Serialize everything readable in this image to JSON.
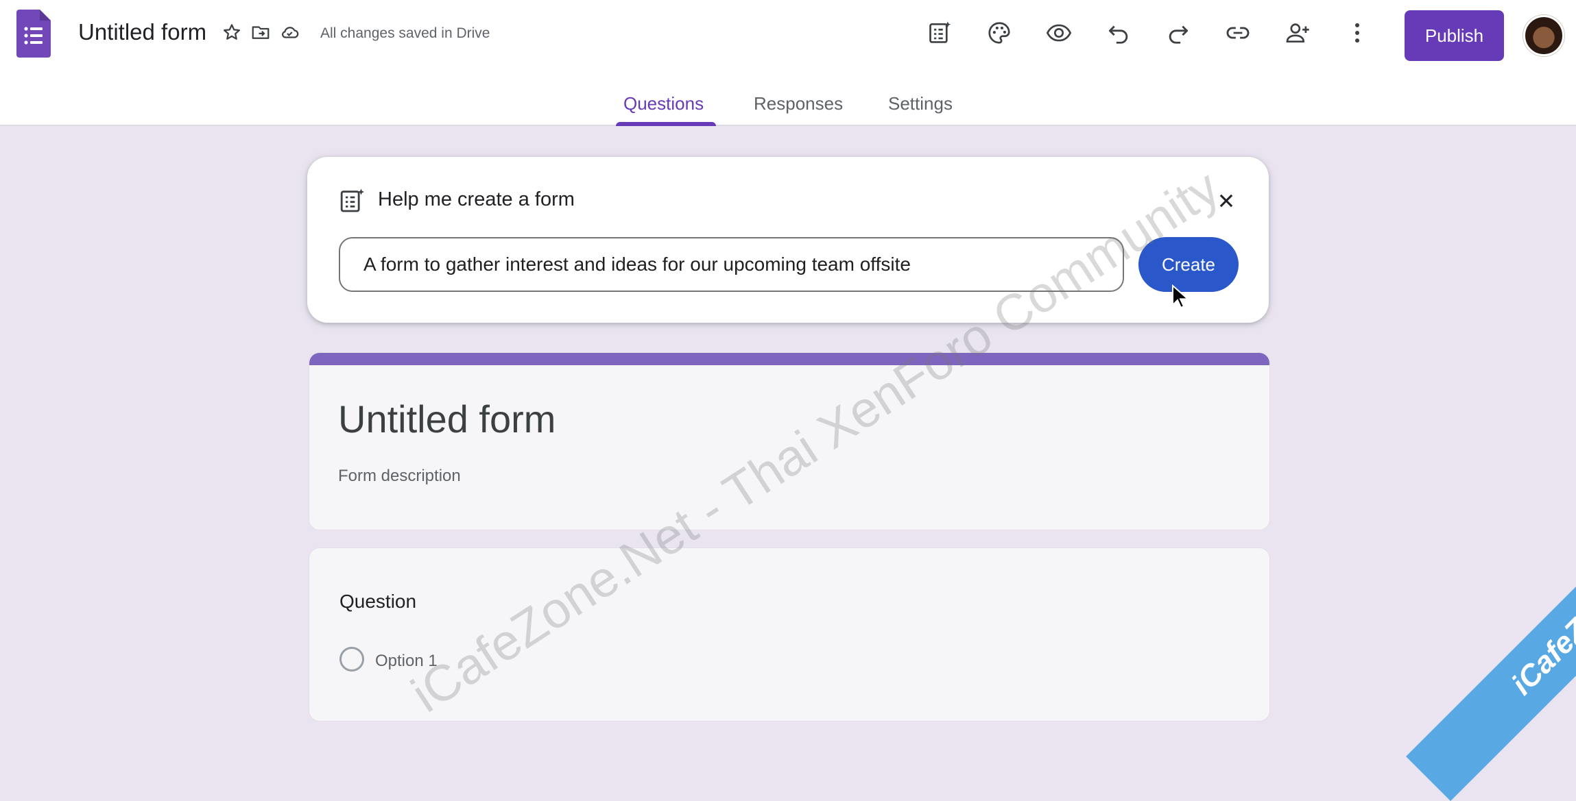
{
  "header": {
    "title": "Untitled form",
    "save_status": "All changes saved in Drive",
    "publish_label": "Publish",
    "icons": {
      "app": "google-forms-icon",
      "star": "star-icon",
      "move": "move-to-folder-icon",
      "cloud": "cloud-saved-icon"
    },
    "toolbar": [
      "ai-form-icon",
      "palette-icon",
      "preview-eye-icon",
      "undo-icon",
      "redo-icon",
      "link-icon",
      "add-collaborator-icon",
      "more-vert-icon"
    ]
  },
  "tabs": {
    "questions": "Questions",
    "responses": "Responses",
    "settings": "Settings",
    "active": "Questions"
  },
  "help": {
    "title": "Help me create a form",
    "prompt_value": "A form to gather interest and ideas for our upcoming team offsite",
    "create_label": "Create"
  },
  "form": {
    "title": "Untitled form",
    "description_placeholder": "Form description",
    "question_label": "Question",
    "option_label": "Option 1"
  },
  "watermarks": {
    "diagonal": "iCafeZone.Net - Thai XenForo Community",
    "ribbon": "iCafeZone"
  },
  "colors": {
    "accent": "#673ab7",
    "background": "#e9e4f0",
    "create_button": "#2a57c9",
    "title_card_bar": "#7e66be"
  }
}
